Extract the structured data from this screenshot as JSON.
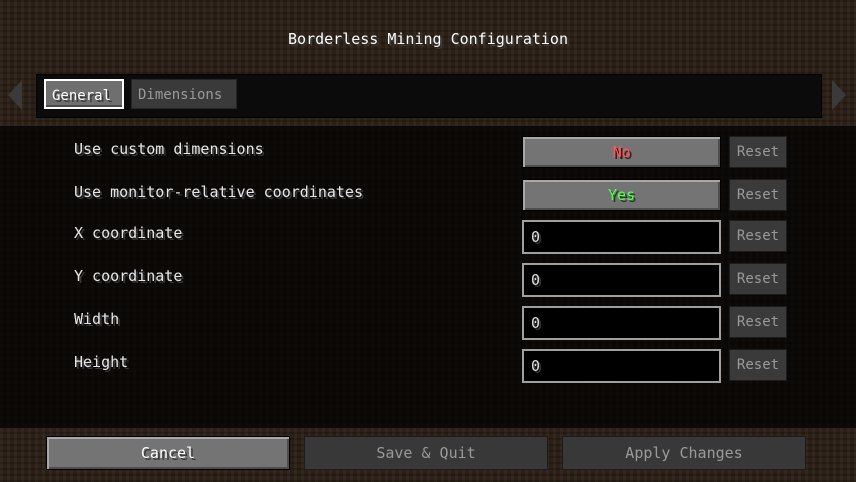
{
  "title": "Borderless Mining Configuration",
  "tabs": [
    {
      "label": "General",
      "active": true
    },
    {
      "label": "Dimensions",
      "active": false
    }
  ],
  "rows": [
    {
      "label": "Use custom dimensions",
      "type": "toggle",
      "value": "No"
    },
    {
      "label": "Use monitor-relative coordinates",
      "type": "toggle",
      "value": "Yes"
    },
    {
      "label": "X coordinate",
      "type": "text",
      "value": "0"
    },
    {
      "label": "Y coordinate",
      "type": "text",
      "value": "0"
    },
    {
      "label": "Width",
      "type": "text",
      "value": "0"
    },
    {
      "label": "Height",
      "type": "text",
      "value": "0"
    }
  ],
  "reset_label": "Reset",
  "footer": {
    "cancel": "Cancel",
    "save_quit": "Save & Quit",
    "apply": "Apply Changes"
  },
  "colors": {
    "toggle_no": "#ff5555",
    "toggle_yes": "#55ff55",
    "button_face": "#747474",
    "disabled_text": "#9a9a9a"
  },
  "icons": {
    "left_arrow": "scroll-left-arrow-icon",
    "right_arrow": "scroll-right-arrow-icon"
  }
}
